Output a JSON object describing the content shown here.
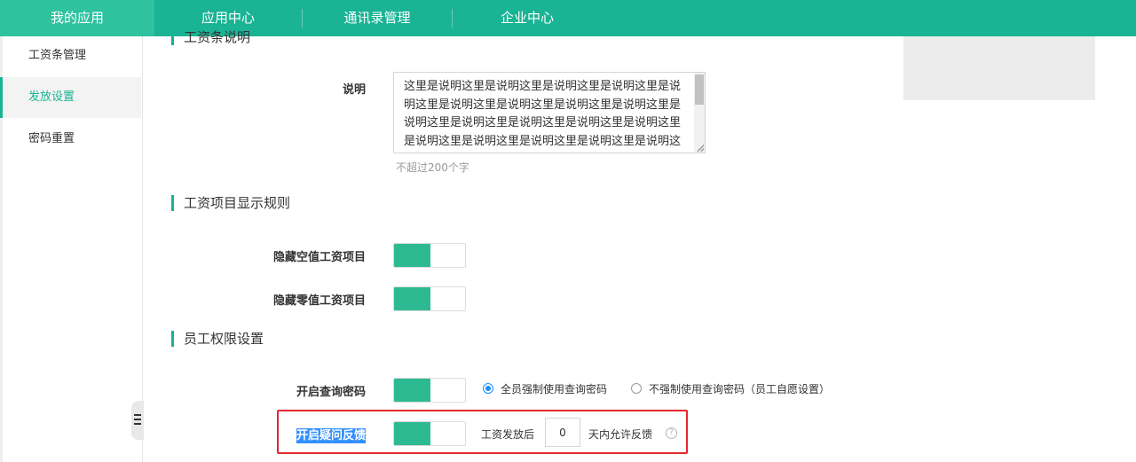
{
  "topnav": {
    "items": [
      {
        "label": "我的应用",
        "active": true
      },
      {
        "label": "应用中心"
      },
      {
        "label": "通讯录管理"
      },
      {
        "label": "企业中心"
      }
    ]
  },
  "sidebar": {
    "items": [
      {
        "label": "工资条管理"
      },
      {
        "label": "发放设置",
        "active": true
      },
      {
        "label": "密码重置"
      }
    ]
  },
  "sections": {
    "payslip_desc_title": "工资条说明",
    "item_display_title": "工资项目显示规则",
    "permission_title": "员工权限设置"
  },
  "description": {
    "label": "说明",
    "value": "这里是说明这里是说明这里是说明这里是说明这里是说明这里是说明这里是说明这里是说明这里是说明这里是说明这里是说明这里是说明这里是说明这里是说明这里是说明这里是说明这里是说明这里是说明这里是说明这里是说明",
    "hint": "不超过200个字"
  },
  "rules": {
    "hide_empty_label": "隐藏空值工资项目",
    "hide_zero_label": "隐藏零值工资项目"
  },
  "permissions": {
    "query_password_label": "开启查询密码",
    "force_option": "全员强制使用查询密码",
    "optional_option": "不强制使用查询密码（员工自愿设置）",
    "feedback_label": "开启疑问反馈",
    "feedback_prefix": "工资发放后",
    "feedback_days": "0",
    "feedback_suffix": "天内允许反馈"
  },
  "colors": {
    "brand": "#1ab394",
    "toggle_on": "#2dba93",
    "highlight": "#e3262f",
    "radio": "#1890ff"
  }
}
